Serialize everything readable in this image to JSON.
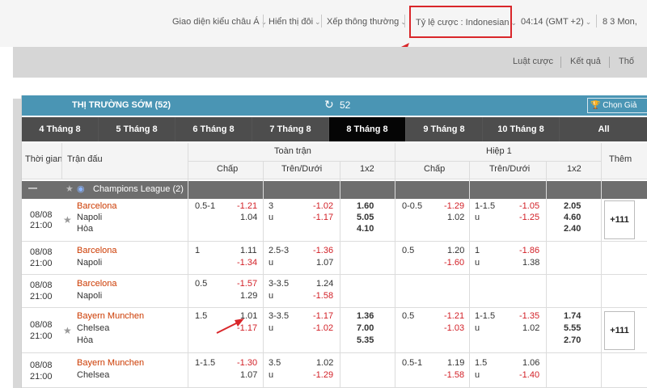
{
  "topbar": {
    "interface": "Giao diện kiểu châu Á",
    "display_pairs": "Hiển thị đôi",
    "sort": "Xếp thông thường",
    "odds_format": "Tỷ lệ cược : Indonesian",
    "time": "04:14 (GMT +2)",
    "date": "8 3 Mon,"
  },
  "subbar": {
    "rules": "Luật cược",
    "results": "Kết quả",
    "more": "Thố"
  },
  "market": {
    "title": "THỊ TRƯỜNG SỚM (52)",
    "count": "52",
    "choose_league": "Chọn Giả"
  },
  "date_tabs": [
    "4 Tháng 8",
    "5 Tháng 8",
    "6 Tháng 8",
    "7 Tháng 8",
    "8 Tháng 8",
    "9 Tháng 8",
    "10 Tháng 8",
    "All"
  ],
  "header": {
    "time": "Thời gian",
    "match": "Trận đấu",
    "full_time": "Toàn trận",
    "half": "Hiệp 1",
    "more": "Thêm",
    "handicap": "Chấp",
    "over_under": "Trên/Dưới",
    "x12": "1x2"
  },
  "league": {
    "collapse": "—",
    "name": "Champions League (2)"
  },
  "matches": [
    {
      "date": "08/08",
      "time": "21:00",
      "home": "Barcelona",
      "away": "Napoli",
      "draw": "Hòa",
      "starred": true,
      "ft_hdp": "0.5-1",
      "ft_hdp_home": "-1.21",
      "ft_hdp_away": "1.04",
      "ft_ou": "3",
      "ft_ou_u": "u",
      "ft_ou_over": "-1.02",
      "ft_ou_under": "-1.17",
      "ft_1x2": [
        "1.60",
        "5.05",
        "4.10"
      ],
      "h1_hdp": "0-0.5",
      "h1_hdp_home": "-1.29",
      "h1_hdp_away": "1.02",
      "h1_ou": "1-1.5",
      "h1_ou_u": "u",
      "h1_ou_over": "-1.05",
      "h1_ou_under": "-1.25",
      "h1_1x2": [
        "2.05",
        "4.60",
        "2.40"
      ],
      "more": "+111"
    },
    {
      "date": "08/08",
      "time": "21:00",
      "home": "Barcelona",
      "away": "Napoli",
      "ft_hdp": "1",
      "ft_hdp_home": "1.11",
      "ft_hdp_away": "-1.34",
      "ft_ou": "2.5-3",
      "ft_ou_u": "u",
      "ft_ou_over": "-1.36",
      "ft_ou_under": "1.07",
      "h1_hdp": "0.5",
      "h1_hdp_home": "1.20",
      "h1_hdp_away": "-1.60",
      "h1_ou": "1",
      "h1_ou_u": "u",
      "h1_ou_over": "-1.86",
      "h1_ou_under": "1.38"
    },
    {
      "date": "08/08",
      "time": "21:00",
      "home": "Barcelona",
      "away": "Napoli",
      "ft_hdp": "0.5",
      "ft_hdp_home": "-1.57",
      "ft_hdp_away": "1.29",
      "ft_ou": "3-3.5",
      "ft_ou_u": "u",
      "ft_ou_over": "1.24",
      "ft_ou_under": "-1.58"
    },
    {
      "date": "08/08",
      "time": "21:00",
      "home": "Bayern Munchen",
      "away": "Chelsea",
      "draw": "Hòa",
      "starred": true,
      "ft_hdp": "1.5",
      "ft_hdp_home": "1.01",
      "ft_hdp_away": "-1.17",
      "ft_ou": "3-3.5",
      "ft_ou_u": "u",
      "ft_ou_over": "-1.17",
      "ft_ou_under": "-1.02",
      "ft_1x2": [
        "1.36",
        "7.00",
        "5.35"
      ],
      "h1_hdp": "0.5",
      "h1_hdp_home": "-1.21",
      "h1_hdp_away": "-1.03",
      "h1_ou": "1-1.5",
      "h1_ou_u": "u",
      "h1_ou_over": "-1.35",
      "h1_ou_under": "1.02",
      "h1_1x2": [
        "1.74",
        "5.55",
        "2.70"
      ],
      "more": "+111"
    },
    {
      "date": "08/08",
      "time": "21:00",
      "home": "Bayern Munchen",
      "away": "Chelsea",
      "ft_hdp": "1-1.5",
      "ft_hdp_home": "-1.30",
      "ft_hdp_away": "1.07",
      "ft_ou": "3.5",
      "ft_ou_u": "u",
      "ft_ou_over": "1.02",
      "ft_ou_under": "-1.29",
      "h1_hdp": "0.5-1",
      "h1_hdp_home": "1.19",
      "h1_hdp_away": "-1.58",
      "h1_ou": "1.5",
      "h1_ou_u": "u",
      "h1_ou_over": "1.06",
      "h1_ou_under": "-1.40"
    }
  ],
  "colors": {
    "header_blue": "#4a95b4",
    "negative_red": "#d21f26",
    "highlight_box": "#d9262a",
    "home_team": "#cc3a00"
  }
}
